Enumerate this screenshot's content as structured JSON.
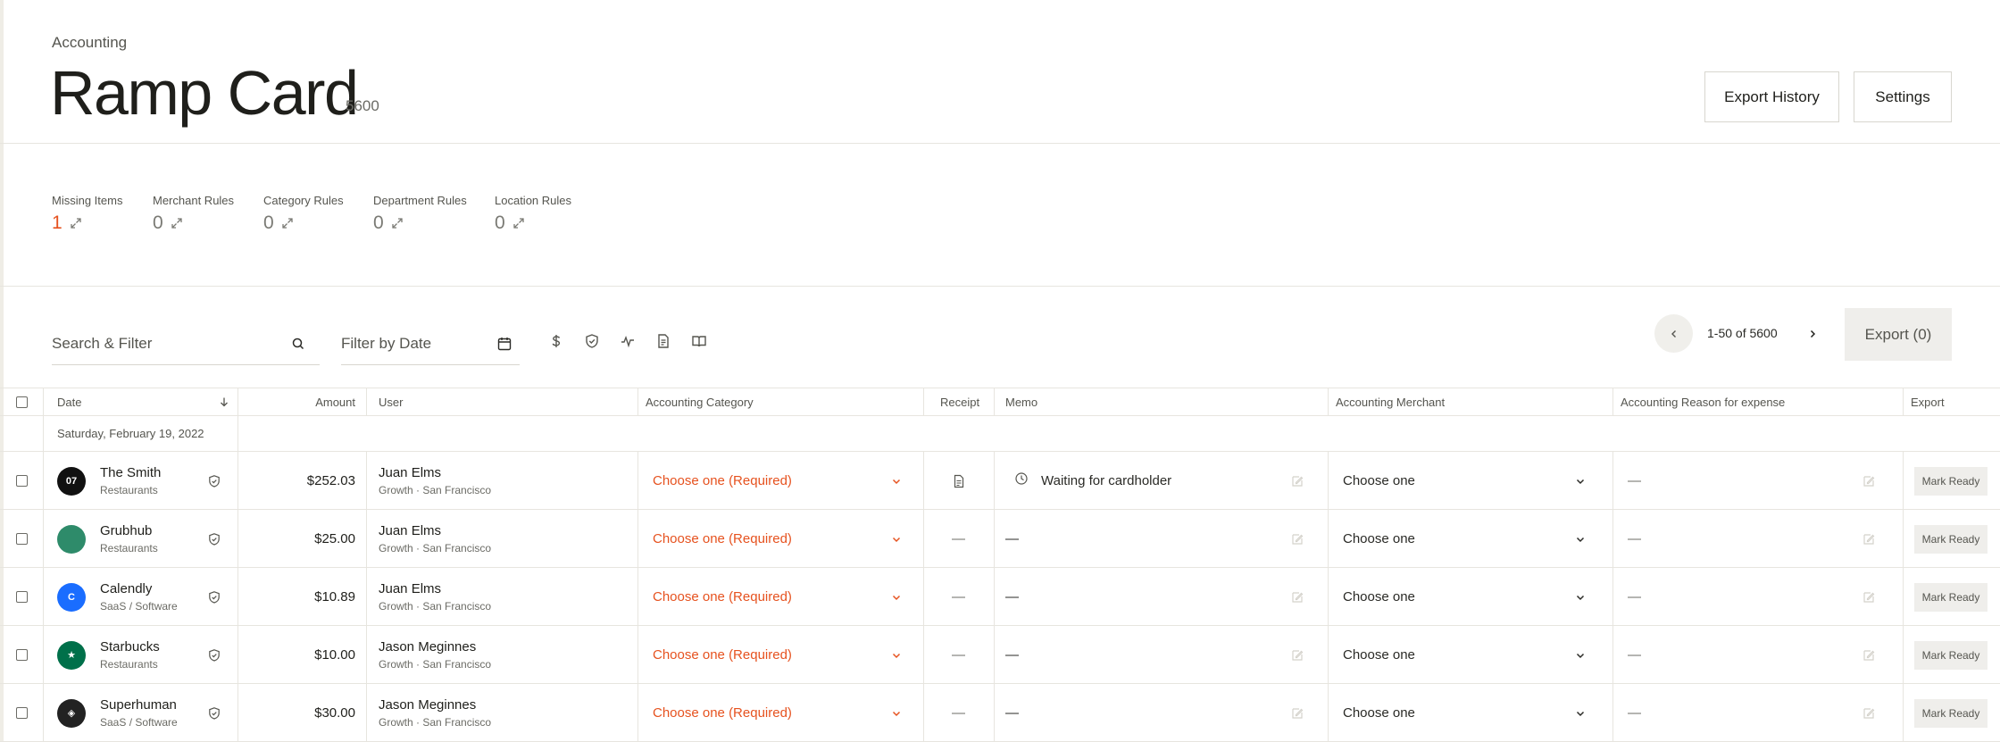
{
  "header": {
    "breadcrumb": "Accounting",
    "title": "Ramp Card",
    "count": "5600",
    "export_history_label": "Export History",
    "settings_label": "Settings"
  },
  "stats": [
    {
      "label": "Missing Items",
      "value": "1"
    },
    {
      "label": "Merchant Rules",
      "value": "0"
    },
    {
      "label": "Category Rules",
      "value": "0"
    },
    {
      "label": "Department Rules",
      "value": "0"
    },
    {
      "label": "Location Rules",
      "value": "0"
    }
  ],
  "toolbar": {
    "search_placeholder": "Search & Filter",
    "date_placeholder": "Filter by Date",
    "pager_text": "1-50 of 5600",
    "export_label": "Export (0)"
  },
  "table": {
    "columns": {
      "date": "Date",
      "amount": "Amount",
      "user": "User",
      "category": "Accounting Category",
      "receipt": "Receipt",
      "memo": "Memo",
      "merchant": "Accounting Merchant",
      "reason": "Accounting Reason for expense",
      "export": "Export"
    },
    "date_group": "Saturday, February 19, 2022",
    "rows": [
      {
        "merchant": "The Smith",
        "merchant_category": "Restaurants",
        "logo_text": "07",
        "logo_color": "#111111",
        "amount": "$252.03",
        "user": "Juan Elms",
        "user_meta": "Growth · San Francisco",
        "category": "Choose one (Required)",
        "receipt": "receipt-icon",
        "memo": "Waiting for cardholder",
        "memo_icon": true,
        "acct_merchant": "Choose one",
        "reason": "—",
        "export_label": "Mark Ready"
      },
      {
        "merchant": "Grubhub",
        "merchant_category": "Restaurants",
        "logo_text": "",
        "logo_color": "#2e8b6a",
        "amount": "$25.00",
        "user": "Juan Elms",
        "user_meta": "Growth · San Francisco",
        "category": "Choose one (Required)",
        "receipt": "—",
        "memo": "—",
        "memo_icon": false,
        "acct_merchant": "Choose one",
        "reason": "—",
        "export_label": "Mark Ready"
      },
      {
        "merchant": "Calendly",
        "merchant_category": "SaaS / Software",
        "logo_text": "C",
        "logo_color": "#1a6dff",
        "amount": "$10.89",
        "user": "Juan Elms",
        "user_meta": "Growth · San Francisco",
        "category": "Choose one (Required)",
        "receipt": "—",
        "memo": "—",
        "memo_icon": false,
        "acct_merchant": "Choose one",
        "reason": "—",
        "export_label": "Mark Ready"
      },
      {
        "merchant": "Starbucks",
        "merchant_category": "Restaurants",
        "logo_text": "★",
        "logo_color": "#00704a",
        "amount": "$10.00",
        "user": "Jason Meginnes",
        "user_meta": "Growth · San Francisco",
        "category": "Choose one (Required)",
        "receipt": "—",
        "memo": "—",
        "memo_icon": false,
        "acct_merchant": "Choose one",
        "reason": "—",
        "export_label": "Mark Ready"
      },
      {
        "merchant": "Superhuman",
        "merchant_category": "SaaS / Software",
        "logo_text": "◈",
        "logo_color": "#222222",
        "amount": "$30.00",
        "user": "Jason Meginnes",
        "user_meta": "Growth · San Francisco",
        "category": "Choose one (Required)",
        "receipt": "—",
        "memo": "—",
        "memo_icon": false,
        "acct_merchant": "Choose one",
        "reason": "—",
        "export_label": "Mark Ready"
      }
    ]
  },
  "colors": {
    "accent": "#e6521f",
    "border": "#e7e5df",
    "muted": "#55554f"
  }
}
